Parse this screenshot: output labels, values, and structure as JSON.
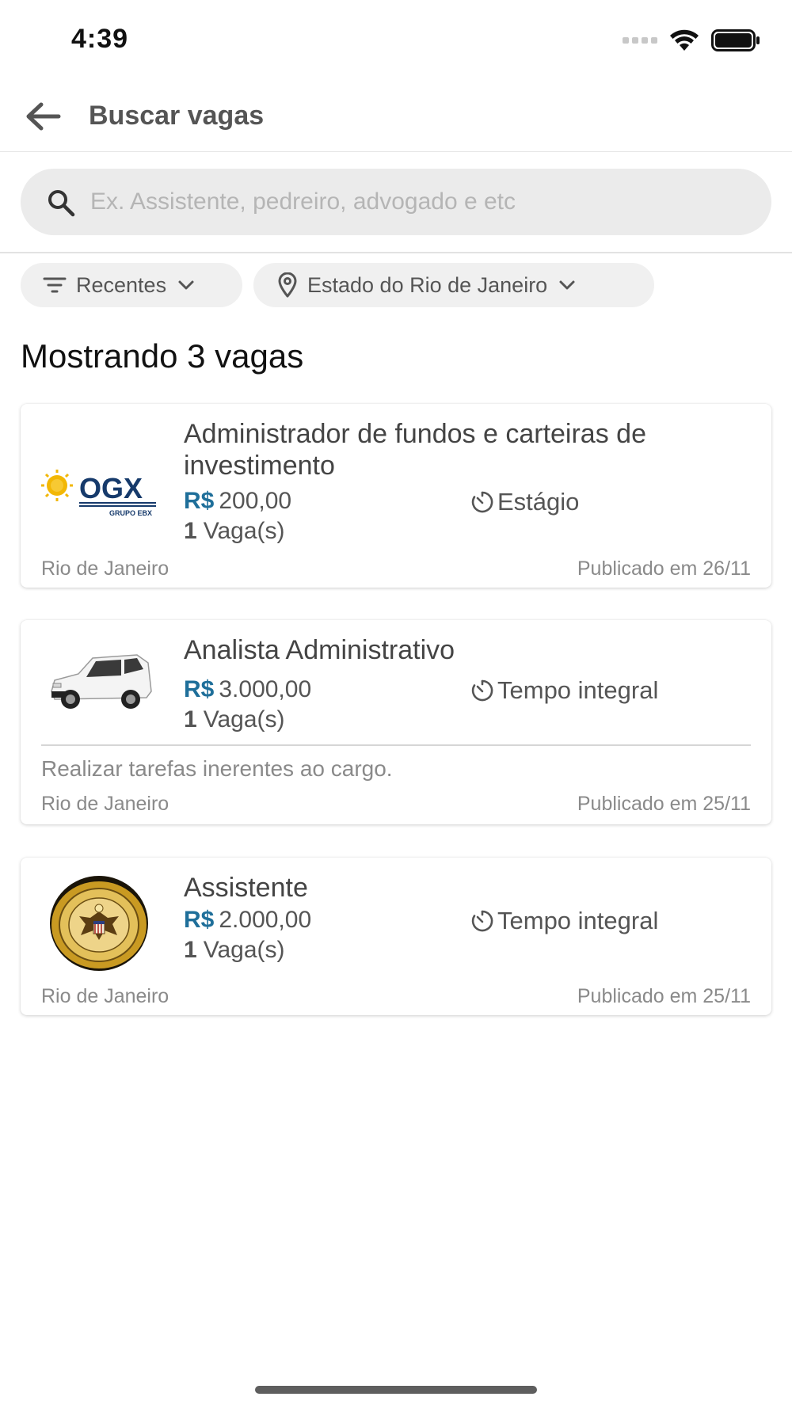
{
  "status_bar": {
    "time": "4:39",
    "icons": [
      "signal-icon",
      "wifi-icon",
      "battery-icon"
    ]
  },
  "header": {
    "back_icon": "arrow-left-icon",
    "title": "Buscar vagas"
  },
  "search": {
    "icon": "search-icon",
    "placeholder": "Ex. Assistente, pedreiro, advogado e etc",
    "value": ""
  },
  "filters": {
    "sort": {
      "icon": "filter-list-icon",
      "label": "Recentes"
    },
    "location": {
      "icon": "location-pin-icon",
      "label": "Estado do Rio de Janeiro"
    }
  },
  "results": {
    "count_text": "Mostrando 3 vagas"
  },
  "jobs": [
    {
      "logo": "ogx-logo",
      "logo_text": "OGX",
      "logo_subtext": "GRUPO EBX",
      "title": "Administrador de fundos e carteiras de investimento",
      "currency": "R$",
      "salary": "200,00",
      "type_icon": "timer-icon",
      "type": "Estágio",
      "vacancies_count": "1",
      "vacancies_label": "Vaga(s)",
      "description": "",
      "location": "Rio de Janeiro",
      "published": "Publicado em 26/11"
    },
    {
      "logo": "white-van-photo",
      "title": "Analista Administrativo",
      "currency": "R$",
      "salary": "3.000,00",
      "type_icon": "timer-icon",
      "type": "Tempo integral",
      "vacancies_count": "1",
      "vacancies_label": "Vaga(s)",
      "description": "Realizar tarefas inerentes ao cargo.",
      "location": "Rio de Janeiro",
      "published": "Publicado em 25/11"
    },
    {
      "logo": "great-seal-emblem",
      "title": "Assistente",
      "currency": "R$",
      "salary": "2.000,00",
      "type_icon": "timer-icon",
      "type": "Tempo integral",
      "vacancies_count": "1",
      "vacancies_label": "Vaga(s)",
      "description": "",
      "location": "Rio de Janeiro",
      "published": "Publicado em 25/11"
    }
  ],
  "colors": {
    "accent": "#1f6f9a",
    "chip_bg": "#f0f0f0",
    "search_bg": "#ebebeb",
    "muted_text": "#8a8a8a"
  }
}
